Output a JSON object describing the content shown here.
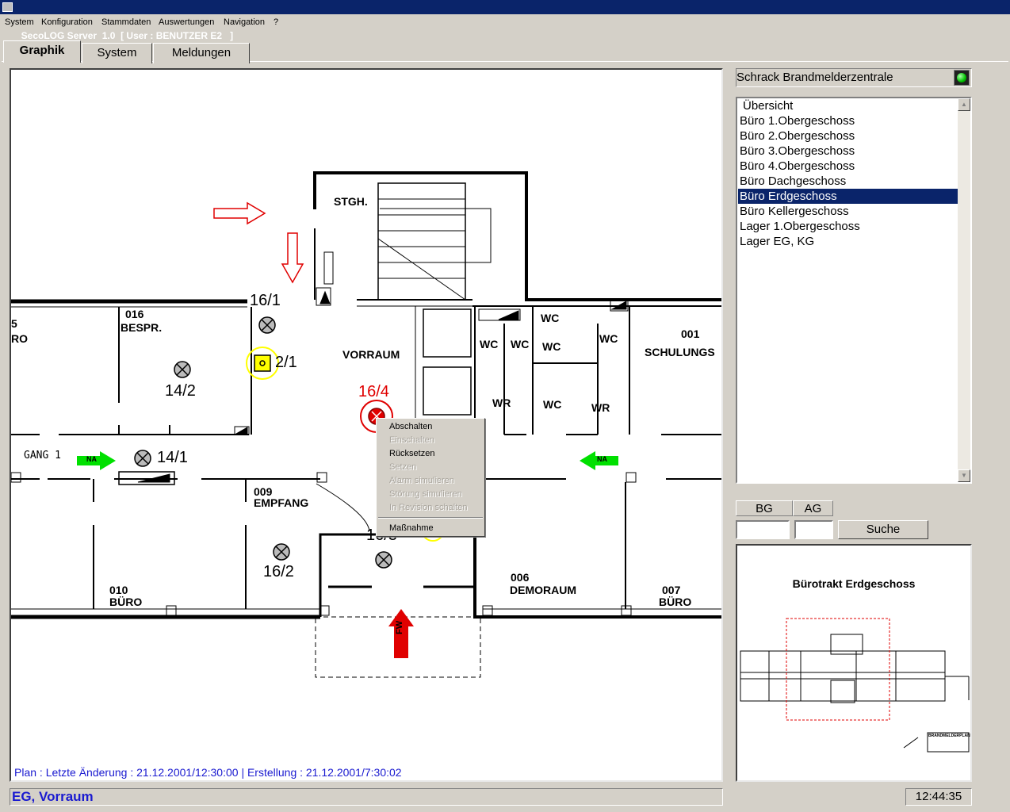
{
  "window": {
    "title": "SecoLOG Server  1.0  [ User : BENUTZER E2   ]"
  },
  "menu": [
    "System",
    "Konfiguration",
    "Stammdaten",
    "Auswertungen",
    "Navigation",
    "?"
  ],
  "tabs": [
    {
      "label": "Graphik",
      "active": true
    },
    {
      "label": "System",
      "active": false
    },
    {
      "label": "Meldungen",
      "active": false
    }
  ],
  "plan": {
    "info": "Plan : Letzte Änderung : 21.12.2001/12:30:00 | Erstellung : 21.12.2001/7:30:02",
    "rooms": {
      "stgh": "STGH.",
      "r016_num": "016",
      "r016_name": "BESPR.",
      "r_left_num": "5",
      "r_left_name": "RO",
      "vorraum": "VORRAUM",
      "gang": "GANG 1",
      "r009_num": "009",
      "r009_name": "EMPFANG",
      "r010_num": "010",
      "r010_name": "BÜRO",
      "r006_num": "006",
      "r006_name": "DEMORAUM",
      "r007_num": "007",
      "r007_name": "BÜRO",
      "r001_num": "001",
      "r001_name": "SCHULUNGS",
      "wc": "WC",
      "wr": "WR"
    },
    "detectors": {
      "d16_1": "16/1",
      "d2_1": "2/1",
      "d14_2": "14/2",
      "d16_4": "16/4",
      "d14_1": "14/1",
      "d16_2": "16/2",
      "d16_3": "16/3"
    },
    "na_label": "NA",
    "fw_label": "FW",
    "colors": {
      "alarm": "#e00000",
      "selected": "#ffff00",
      "arrow_na": "#00e000"
    }
  },
  "context_menu": {
    "items": [
      {
        "label": "Abschalten",
        "enabled": true
      },
      {
        "label": "Einschalten",
        "enabled": false
      },
      {
        "label": "Rücksetzen",
        "enabled": true
      },
      {
        "label": "Setzen",
        "enabled": false
      },
      {
        "label": "Alarm simulieren",
        "enabled": false
      },
      {
        "label": "Störung simulieren",
        "enabled": false
      },
      {
        "label": "In Revision schalten",
        "enabled": false
      },
      {
        "label": "Maßnahme",
        "enabled": true
      }
    ]
  },
  "panel": {
    "title": "Schrack Brandmelderzentrale",
    "led_color": "#00c000",
    "floors": [
      "Übersicht",
      "Büro 1.Obergeschoss",
      "Büro 2.Obergeschoss",
      "Büro 3.Obergeschoss",
      "Büro 4.Obergeschoss",
      "Büro Dachgeschoss",
      "Büro Erdgeschoss",
      "Büro Kellergeschoss",
      "Lager 1.Obergeschoss",
      "Lager EG, KG"
    ],
    "selected_floor": "Büro Erdgeschoss",
    "bg_label": "BG",
    "ag_label": "AG",
    "search_label": "Suche",
    "overview_title": "Bürotrakt Erdgeschoss",
    "overview_legend": "BRANDMELDERPLAN"
  },
  "status": {
    "location": "EG, Vorraum",
    "time": "12:44:35"
  }
}
